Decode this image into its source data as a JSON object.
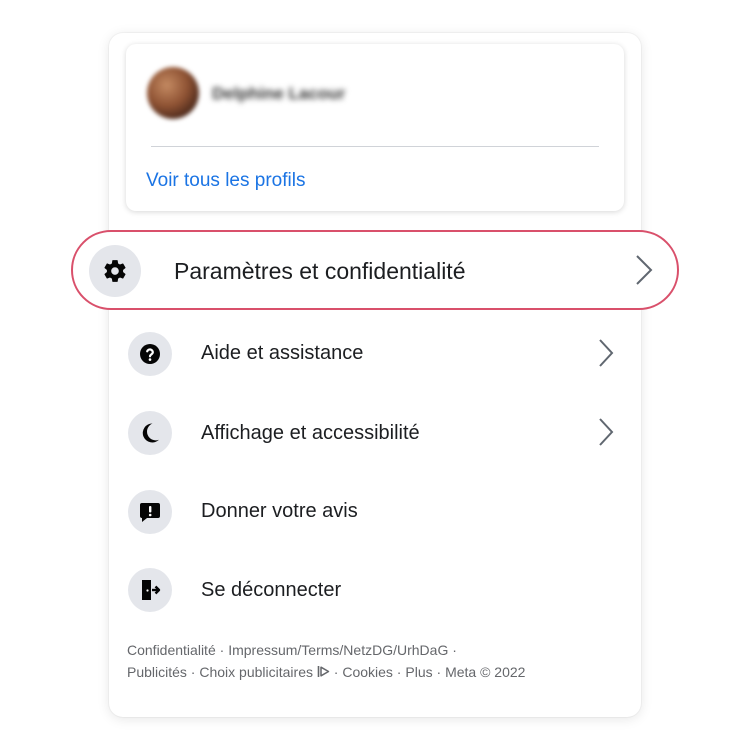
{
  "profile": {
    "name": "Delphine Lacour",
    "see_all_label": "Voir tous les profils"
  },
  "menu": {
    "highlighted": {
      "label": "Paramètres et confidentialité",
      "icon": "gear-icon"
    },
    "items": [
      {
        "label": "Aide et assistance",
        "icon": "question-icon",
        "has_chevron": true
      },
      {
        "label": "Affichage et accessibilité",
        "icon": "moon-icon",
        "has_chevron": true
      },
      {
        "label": "Donner votre avis",
        "icon": "feedback-icon",
        "has_chevron": false
      },
      {
        "label": "Se déconnecter",
        "icon": "logout-icon",
        "has_chevron": false
      }
    ]
  },
  "footer": {
    "line1": "Confidentialité · Impressum/Terms/NetzDG/UrhDaG ·",
    "privacy": "Confidentialité",
    "impressum": "Impressum/Terms/NetzDG/UrhDaG",
    "ads": "Publicités",
    "ad_choices": "Choix publicitaires",
    "cookies": "Cookies",
    "more": "Plus",
    "meta": "Meta © 2022",
    "sep": " · "
  },
  "colors": {
    "accent": "#1b74e4",
    "highlight_border": "#d9506b",
    "icon_bg": "#e4e6eb"
  }
}
